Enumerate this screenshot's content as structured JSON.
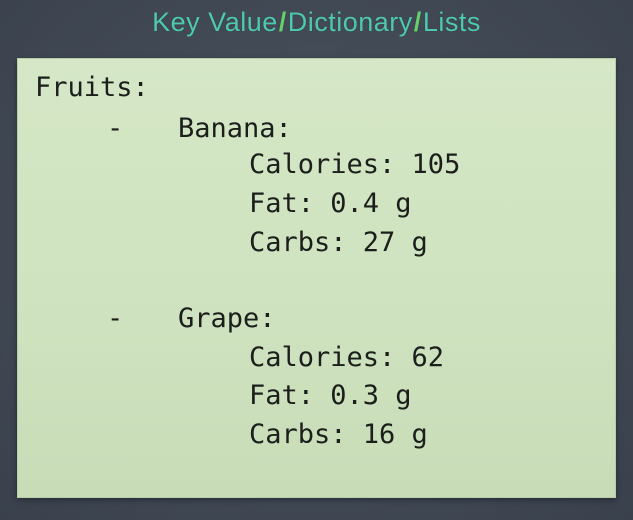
{
  "title": {
    "part1": "Key Value",
    "part2": "Dictionary",
    "part3": "Lists",
    "separator": "/",
    "color": "#4ec9b0",
    "separator_color": "#66d06a"
  },
  "panel": {
    "background": "#d1e5c3",
    "root_label": "Fruits:",
    "items": [
      {
        "bullet": "-",
        "name": "Banana:",
        "fields": [
          "Calories: 105",
          "Fat: 0.4 g",
          "Carbs: 27 g"
        ]
      },
      {
        "bullet": "-",
        "name": "Grape:",
        "fields": [
          "Calories: 62",
          "Fat: 0.3 g",
          "Carbs: 16 g"
        ]
      }
    ]
  }
}
